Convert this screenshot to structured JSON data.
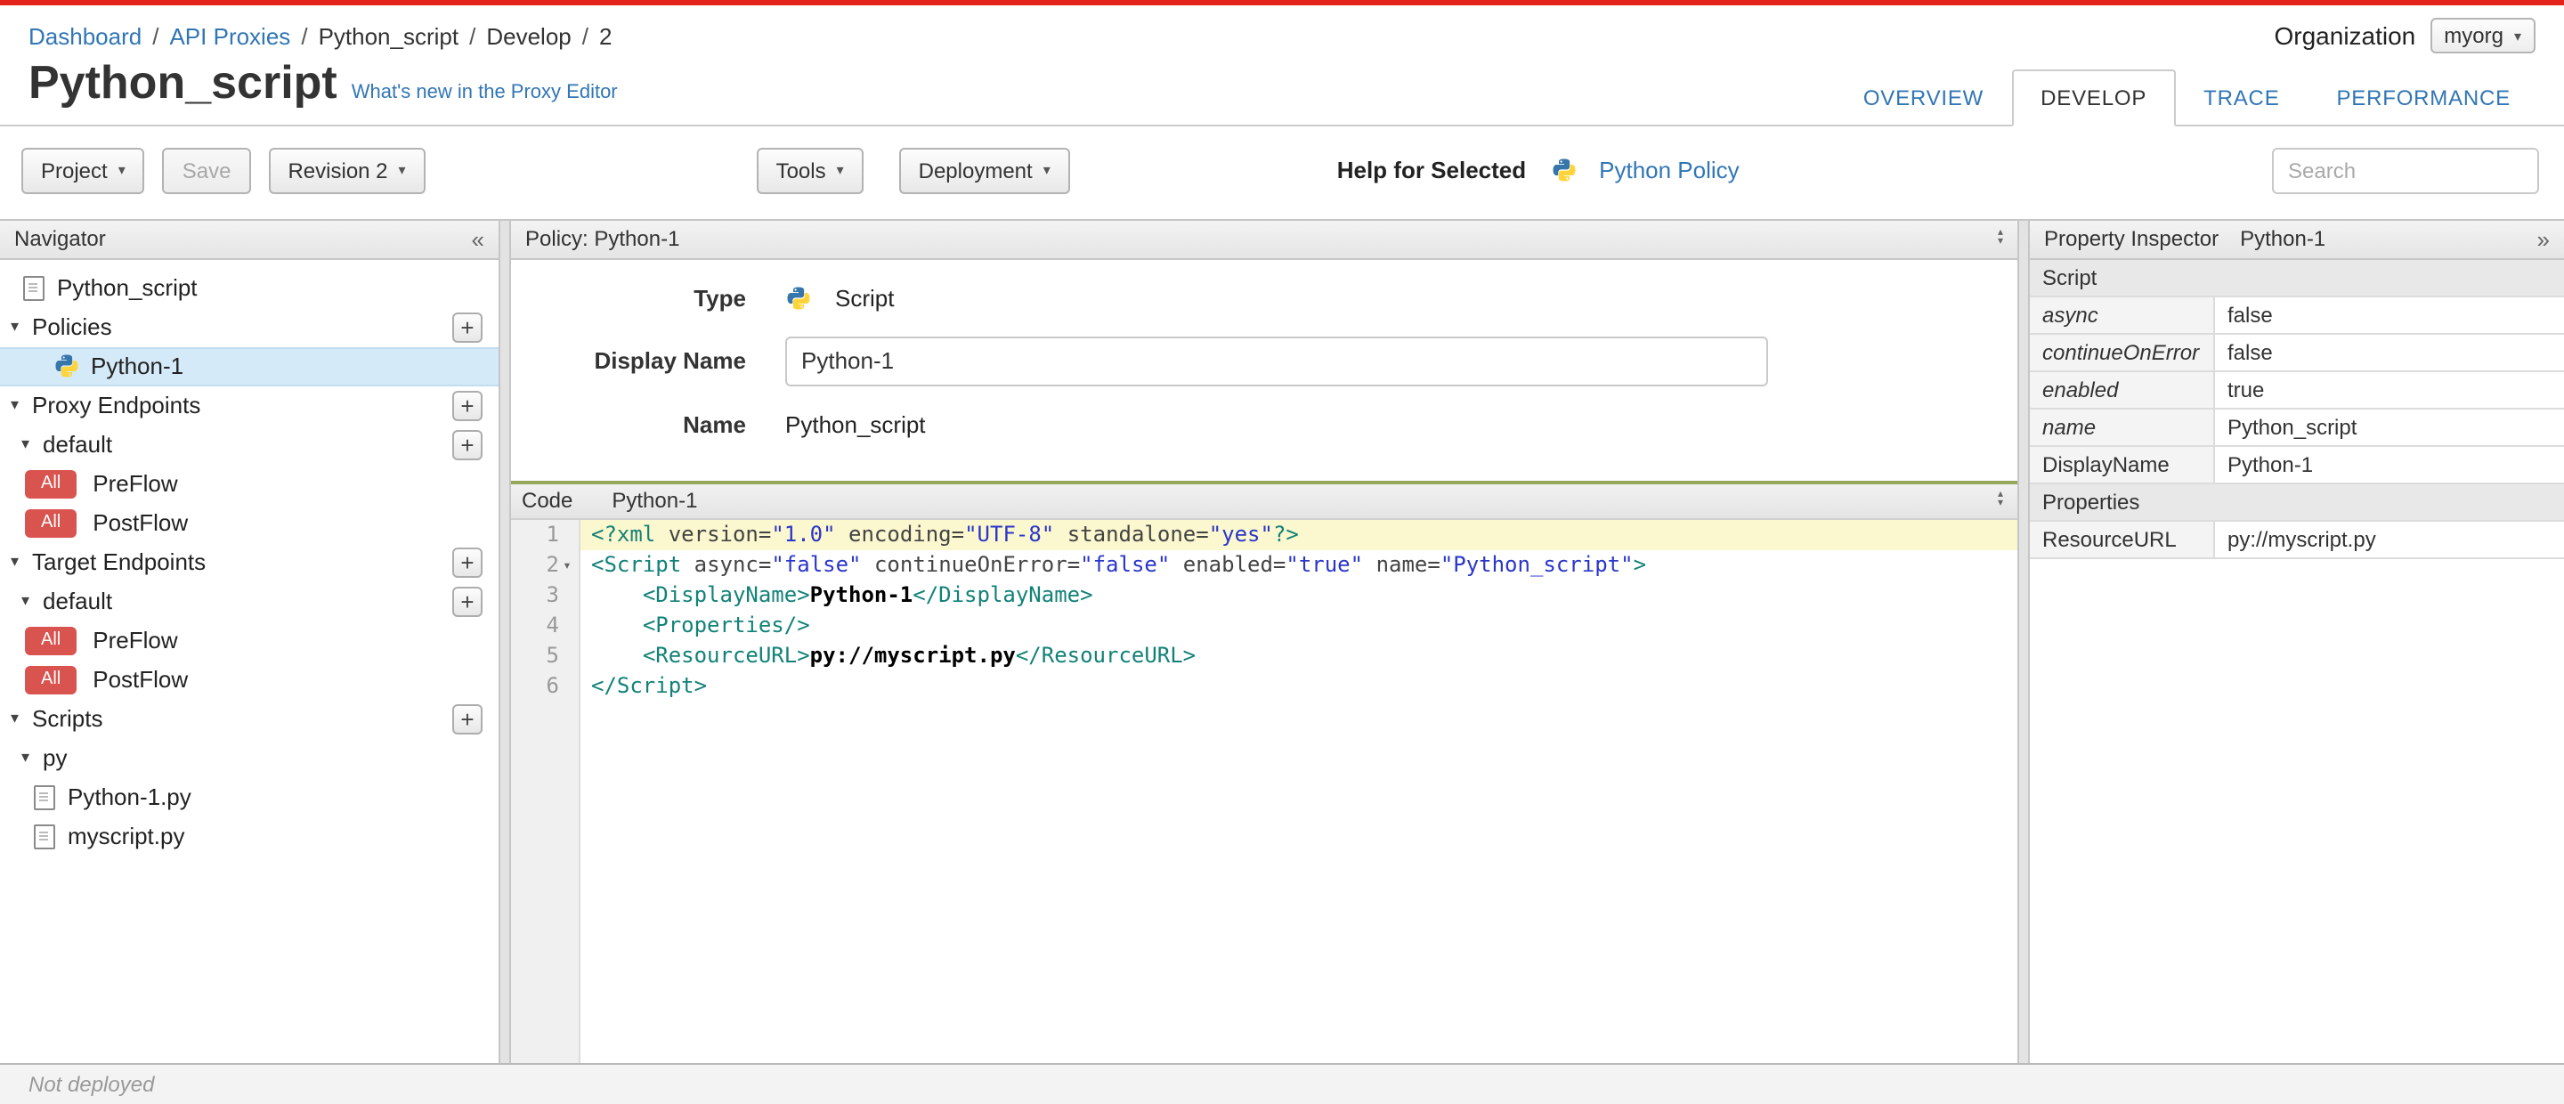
{
  "icons": {
    "caret_down": "▾",
    "tree_expanded": "▾",
    "plus": "+",
    "collapse_left": "«",
    "collapse_right": "»",
    "fold": "▾",
    "panel_resize_up": "▴",
    "panel_resize_down": "▾"
  },
  "breadcrumb": {
    "separator": "/",
    "items": [
      {
        "label": "Dashboard",
        "link": true
      },
      {
        "label": "API Proxies",
        "link": true
      },
      {
        "label": "Python_script",
        "link": false
      },
      {
        "label": "Develop",
        "link": false
      },
      {
        "label": "2",
        "link": false
      }
    ]
  },
  "organization": {
    "label": "Organization",
    "value": "myorg"
  },
  "page": {
    "title": "Python_script",
    "whats_new_label": "What's new in the Proxy Editor"
  },
  "tabs": [
    {
      "label": "OVERVIEW",
      "active": false
    },
    {
      "label": "DEVELOP",
      "active": true
    },
    {
      "label": "TRACE",
      "active": false
    },
    {
      "label": "PERFORMANCE",
      "active": false
    }
  ],
  "toolbar": {
    "project_label": "Project",
    "save_label": "Save",
    "revision_label": "Revision 2",
    "tools_label": "Tools",
    "deployment_label": "Deployment",
    "help_for_selected_label": "Help for Selected",
    "policy_link_label": "Python Policy",
    "search_placeholder": "Search"
  },
  "navigator": {
    "title": "Navigator",
    "items": [
      {
        "label": "Python_script",
        "indent": 12,
        "icon": "file"
      },
      {
        "label": "Policies",
        "indent": 6,
        "arrow": true,
        "plus": true
      },
      {
        "label": "Python-1",
        "indent": 30,
        "icon": "python",
        "selected": true
      },
      {
        "label": "Proxy Endpoints",
        "indent": 6,
        "arrow": true,
        "plus": true
      },
      {
        "label": "default",
        "indent": 12,
        "arrow": true,
        "plus": true
      },
      {
        "label": "PreFlow",
        "indent": 14,
        "badge": "All"
      },
      {
        "label": "PostFlow",
        "indent": 14,
        "badge": "All"
      },
      {
        "label": "Target Endpoints",
        "indent": 6,
        "arrow": true,
        "plus": true
      },
      {
        "label": "default",
        "indent": 12,
        "arrow": true,
        "plus": true
      },
      {
        "label": "PreFlow",
        "indent": 14,
        "badge": "All"
      },
      {
        "label": "PostFlow",
        "indent": 14,
        "badge": "All"
      },
      {
        "label": "Scripts",
        "indent": 6,
        "arrow": true,
        "plus": true
      },
      {
        "label": "py",
        "indent": 12,
        "arrow": true
      },
      {
        "label": "Python-1.py",
        "indent": 18,
        "icon": "file"
      },
      {
        "label": "myscript.py",
        "indent": 18,
        "icon": "file"
      }
    ]
  },
  "policy_panel": {
    "title": "Policy: Python-1",
    "type_label": "Type",
    "type_value": "Script",
    "display_name_label": "Display Name",
    "display_name_value": "Python-1",
    "name_label": "Name",
    "name_value": "Python_script"
  },
  "code_panel": {
    "tab_label": "Code",
    "title": "Python-1",
    "lines": [
      {
        "no": 1,
        "highlight": true,
        "fold": false,
        "segs": [
          [
            "t",
            "<?xml"
          ],
          [
            "pl",
            " "
          ],
          [
            "a",
            "version="
          ],
          [
            "s",
            "\"1.0\""
          ],
          [
            "pl",
            " "
          ],
          [
            "a",
            "encoding="
          ],
          [
            "s",
            "\"UTF-8\""
          ],
          [
            "pl",
            " "
          ],
          [
            "a",
            "standalone="
          ],
          [
            "s",
            "\"yes\""
          ],
          [
            "t",
            "?>"
          ]
        ]
      },
      {
        "no": 2,
        "highlight": false,
        "fold": true,
        "segs": [
          [
            "t",
            "<Script"
          ],
          [
            "pl",
            " "
          ],
          [
            "a",
            "async="
          ],
          [
            "s",
            "\"false\""
          ],
          [
            "pl",
            " "
          ],
          [
            "a",
            "continueOnError="
          ],
          [
            "s",
            "\"false\""
          ],
          [
            "pl",
            " "
          ],
          [
            "a",
            "enabled="
          ],
          [
            "s",
            "\"true\""
          ],
          [
            "pl",
            " "
          ],
          [
            "a",
            "name="
          ],
          [
            "s",
            "\"Python_script\""
          ],
          [
            "t",
            ">"
          ]
        ]
      },
      {
        "no": 3,
        "highlight": false,
        "fold": false,
        "segs": [
          [
            "pl",
            "    "
          ],
          [
            "t",
            "<DisplayName>"
          ],
          [
            "x",
            "Python-1"
          ],
          [
            "t",
            "</DisplayName>"
          ]
        ]
      },
      {
        "no": 4,
        "highlight": false,
        "fold": false,
        "segs": [
          [
            "pl",
            "    "
          ],
          [
            "t",
            "<Properties/>"
          ]
        ]
      },
      {
        "no": 5,
        "highlight": false,
        "fold": false,
        "segs": [
          [
            "pl",
            "    "
          ],
          [
            "t",
            "<ResourceURL>"
          ],
          [
            "x",
            "py://myscript.py"
          ],
          [
            "t",
            "</ResourceURL>"
          ]
        ]
      },
      {
        "no": 6,
        "highlight": false,
        "fold": false,
        "segs": [
          [
            "t",
            "</Script>"
          ]
        ]
      }
    ]
  },
  "property_inspector": {
    "title": "Property Inspector",
    "subtitle": "Python-1",
    "rows": [
      {
        "kind": "section",
        "name": "Script",
        "value": ""
      },
      {
        "kind": "attr",
        "name": "async",
        "value": "false"
      },
      {
        "kind": "attr",
        "name": "continueOnError",
        "value": "false"
      },
      {
        "kind": "attr",
        "name": "enabled",
        "value": "true"
      },
      {
        "kind": "attr",
        "name": "name",
        "value": "Python_script"
      },
      {
        "kind": "elem",
        "name": "DisplayName",
        "value": "Python-1"
      },
      {
        "kind": "section",
        "name": "Properties",
        "value": ""
      },
      {
        "kind": "elem",
        "name": "ResourceURL",
        "value": "py://myscript.py"
      }
    ]
  },
  "statusbar": {
    "text": "Not deployed"
  },
  "colors": {
    "brand_red": "#e2231a",
    "link_blue": "#3176b5",
    "selection_blue": "#d5eaf8",
    "badge_red": "#d9534f",
    "code_accent_green": "#94a75a"
  }
}
